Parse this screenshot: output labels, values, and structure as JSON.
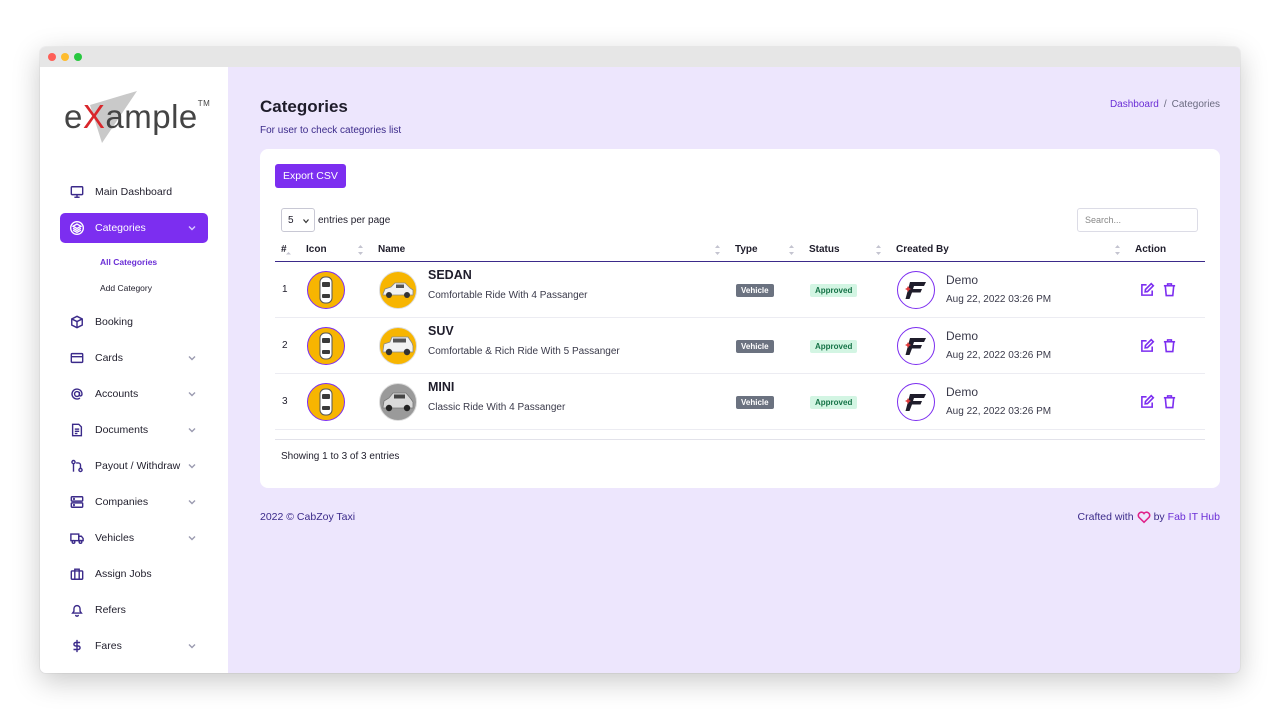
{
  "app": {
    "logo_text_pre": "e",
    "logo_text_x": "X",
    "logo_text_post": "ample",
    "logo_tm": "TM"
  },
  "sidebar": {
    "items": [
      {
        "label": "Main Dashboard",
        "icon": "monitor-icon"
      },
      {
        "label": "Categories",
        "icon": "layers-icon",
        "active": true
      },
      {
        "label": "Booking",
        "icon": "box-icon"
      },
      {
        "label": "Cards",
        "icon": "credit-card-icon"
      },
      {
        "label": "Accounts",
        "icon": "at-sign-icon"
      },
      {
        "label": "Documents",
        "icon": "document-icon"
      },
      {
        "label": "Payout / Withdraw",
        "icon": "git-pull-icon"
      },
      {
        "label": "Companies",
        "icon": "server-icon"
      },
      {
        "label": "Vehicles",
        "icon": "truck-icon"
      },
      {
        "label": "Assign Jobs",
        "icon": "briefcase-icon"
      },
      {
        "label": "Refers",
        "icon": "bell-icon"
      },
      {
        "label": "Fares",
        "icon": "dollar-icon"
      }
    ],
    "sub_items": [
      {
        "label": "All Categories",
        "active": true
      },
      {
        "label": "Add Category"
      }
    ]
  },
  "header": {
    "title": "Categories",
    "subtitle": "For user to check categories list",
    "breadcrumb": [
      "Dashboard",
      "Categories"
    ],
    "breadcrumb_sep": "/"
  },
  "toolbar": {
    "export_label": "Export CSV",
    "per_page_value": "5",
    "per_page_label": "entries per page",
    "search_placeholder": "Search..."
  },
  "table": {
    "columns": [
      "#",
      "Icon",
      "Name",
      "Type",
      "Status",
      "Created By",
      "Action"
    ],
    "rows": [
      {
        "num": "1",
        "name": "SEDAN",
        "desc": "Comfortable Ride With 4 Passanger",
        "type": "Vehicle",
        "status": "Approved",
        "creator": "Demo",
        "created_at": "Aug 22, 2022 03:26 PM"
      },
      {
        "num": "2",
        "name": "SUV",
        "desc": "Comfortable & Rich Ride With 5 Passanger",
        "type": "Vehicle",
        "status": "Approved",
        "creator": "Demo",
        "created_at": "Aug 22, 2022 03:26 PM"
      },
      {
        "num": "3",
        "name": "MINI",
        "desc": "Classic Ride With 4 Passanger",
        "type": "Vehicle",
        "status": "Approved",
        "creator": "Demo",
        "created_at": "Aug 22, 2022 03:26 PM"
      }
    ],
    "showing": "Showing 1 to 3 of 3 entries"
  },
  "footer": {
    "copyright": "2022 © CabZoy Taxi",
    "crafted": "Crafted with",
    "by": "by",
    "company": "Fab IT Hub"
  },
  "colors": {
    "accent": "#7c2ef0",
    "background": "#ede6fd",
    "status_bg": "#d3f5e3",
    "status_text": "#157347",
    "type_badge": "#6b7280",
    "icon_yellow": "#f7b501"
  }
}
